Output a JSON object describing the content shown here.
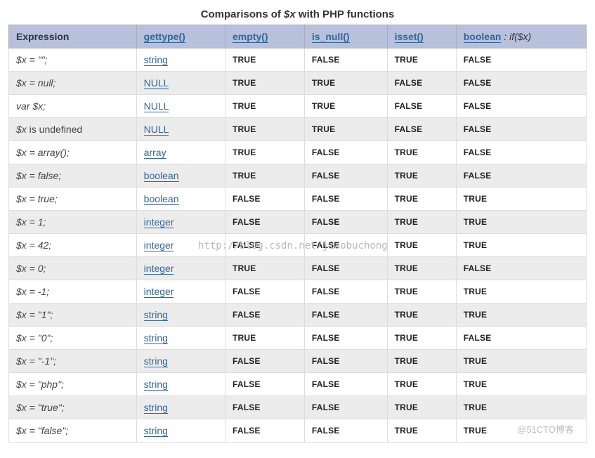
{
  "title_prefix": "Comparisons of ",
  "title_var": "$x",
  "title_suffix": " with PHP functions",
  "headers": {
    "expression": "Expression",
    "gettype": "gettype()",
    "empty": "empty()",
    "is_null": "is_null()",
    "isset": "isset()",
    "boolean": "boolean",
    "boolean_suffix": " : if($x)"
  },
  "rows": [
    {
      "expr": "$x = \"\";",
      "type": "string",
      "empty": "TRUE",
      "is_null": "FALSE",
      "isset": "TRUE",
      "bool": "FALSE"
    },
    {
      "expr": "$x = null;",
      "type": "NULL",
      "empty": "TRUE",
      "is_null": "TRUE",
      "isset": "FALSE",
      "bool": "FALSE"
    },
    {
      "expr": "var $x;",
      "type": "NULL",
      "empty": "TRUE",
      "is_null": "TRUE",
      "isset": "FALSE",
      "bool": "FALSE"
    },
    {
      "expr_prefix": "$x",
      "expr_plain": " is undefined",
      "type": "NULL",
      "empty": "TRUE",
      "is_null": "TRUE",
      "isset": "FALSE",
      "bool": "FALSE"
    },
    {
      "expr": "$x = array();",
      "type": "array",
      "empty": "TRUE",
      "is_null": "FALSE",
      "isset": "TRUE",
      "bool": "FALSE"
    },
    {
      "expr": "$x = false;",
      "type": "boolean",
      "empty": "TRUE",
      "is_null": "FALSE",
      "isset": "TRUE",
      "bool": "FALSE"
    },
    {
      "expr": "$x = true;",
      "type": "boolean",
      "empty": "FALSE",
      "is_null": "FALSE",
      "isset": "TRUE",
      "bool": "TRUE"
    },
    {
      "expr": "$x = 1;",
      "type": "integer",
      "empty": "FALSE",
      "is_null": "FALSE",
      "isset": "TRUE",
      "bool": "TRUE"
    },
    {
      "expr": "$x = 42;",
      "type": "integer",
      "empty": "FALSE",
      "is_null": "FALSE",
      "isset": "TRUE",
      "bool": "TRUE"
    },
    {
      "expr": "$x = 0;",
      "type": "integer",
      "empty": "TRUE",
      "is_null": "FALSE",
      "isset": "TRUE",
      "bool": "FALSE"
    },
    {
      "expr": "$x = -1;",
      "type": "integer",
      "empty": "FALSE",
      "is_null": "FALSE",
      "isset": "TRUE",
      "bool": "TRUE"
    },
    {
      "expr": "$x = \"1\";",
      "type": "string",
      "empty": "FALSE",
      "is_null": "FALSE",
      "isset": "TRUE",
      "bool": "TRUE"
    },
    {
      "expr": "$x = \"0\";",
      "type": "string",
      "empty": "TRUE",
      "is_null": "FALSE",
      "isset": "TRUE",
      "bool": "FALSE"
    },
    {
      "expr": "$x = \"-1\";",
      "type": "string",
      "empty": "FALSE",
      "is_null": "FALSE",
      "isset": "TRUE",
      "bool": "TRUE"
    },
    {
      "expr": "$x = \"php\";",
      "type": "string",
      "empty": "FALSE",
      "is_null": "FALSE",
      "isset": "TRUE",
      "bool": "TRUE"
    },
    {
      "expr": "$x = \"true\";",
      "type": "string",
      "empty": "FALSE",
      "is_null": "FALSE",
      "isset": "TRUE",
      "bool": "TRUE"
    },
    {
      "expr": "$x = \"false\";",
      "type": "string",
      "empty": "FALSE",
      "is_null": "FALSE",
      "isset": "TRUE",
      "bool": "TRUE"
    }
  ],
  "watermark": "http://blog.csdn.net/jiaobuchong",
  "footer": "@51CTO博客"
}
